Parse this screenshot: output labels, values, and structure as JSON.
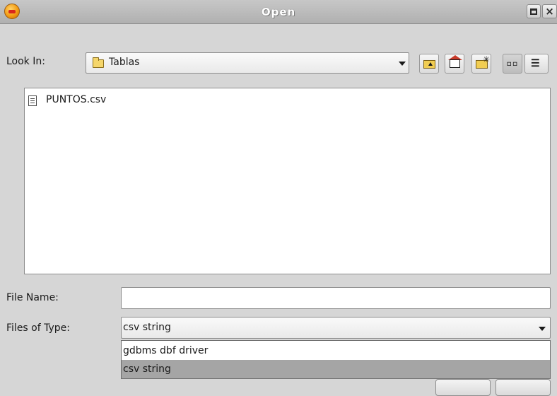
{
  "window": {
    "title": "Open",
    "icons": {
      "app": "gvsig-app-icon",
      "maximize": "maximize-icon",
      "close": "close-icon"
    },
    "close_glyph": "×"
  },
  "look_in": {
    "label": "Look In:",
    "value": "Tablas",
    "icon": "folder-icon"
  },
  "toolbar": {
    "up_icon": "up-one-level-icon",
    "home_icon": "home-icon",
    "new_folder_icon": "new-folder-icon",
    "list_view_icon": "list-view-icon",
    "details_view_icon": "details-view-icon"
  },
  "files": [
    {
      "name": "PUNTOS.csv",
      "icon": "document-icon"
    }
  ],
  "file_name": {
    "label": "File Name:",
    "value": ""
  },
  "files_of_type": {
    "label": "Files of Type:",
    "value": "csv string",
    "options": [
      "gdbms dbf driver",
      "csv string"
    ],
    "highlighted_index": 1
  },
  "colors": {
    "background": "#d6d6d6",
    "titlebar": "#b8b8b8",
    "selection": "#a5a5a5"
  }
}
